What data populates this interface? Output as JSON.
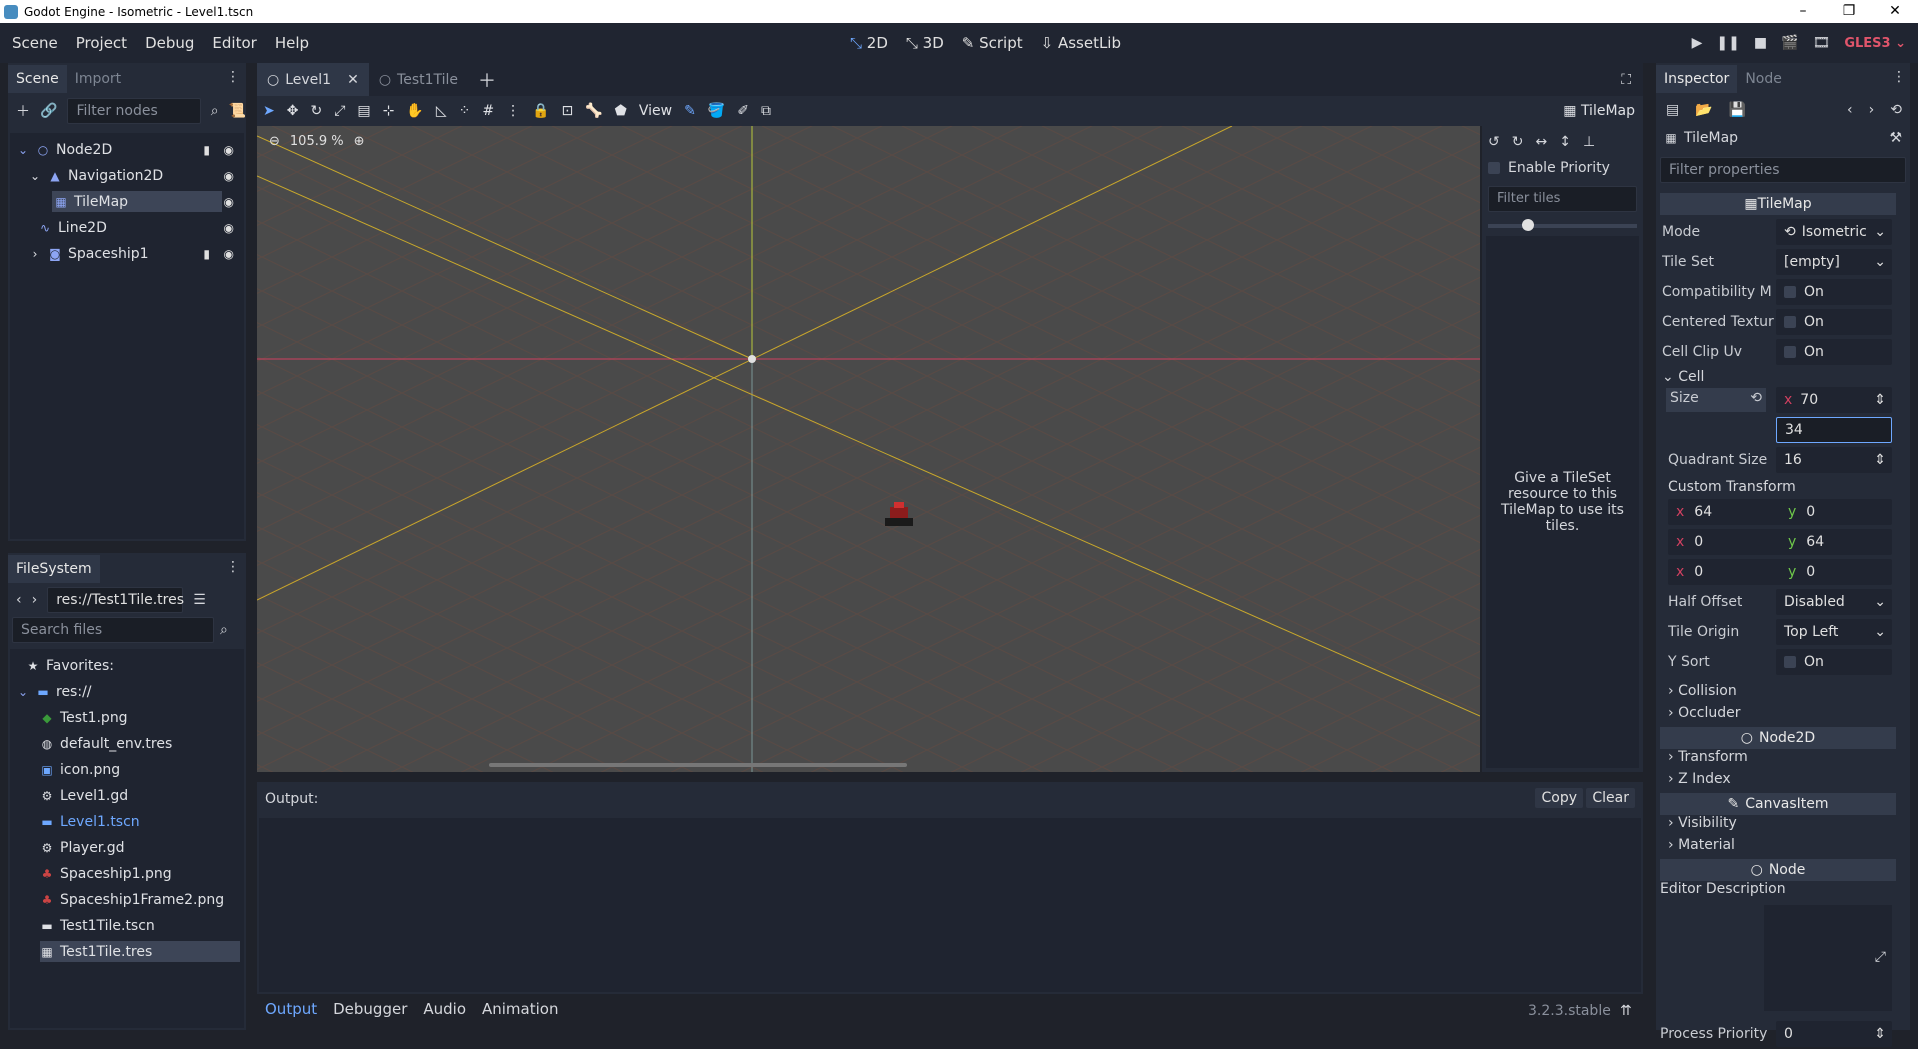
{
  "window": {
    "title": "Godot Engine - Isometric - Level1.tscn",
    "controls": [
      "–",
      "❐",
      "✕"
    ]
  },
  "menu": [
    "Scene",
    "Project",
    "Debug",
    "Editor",
    "Help"
  ],
  "workspaces": {
    "d2": "2D",
    "d3": "3D",
    "script": "Script",
    "assetlib": "AssetLib"
  },
  "renderer": "GLES3",
  "scene_dock": {
    "tab_scene": "Scene",
    "tab_import": "Import",
    "filter_placeholder": "Filter nodes",
    "nodes": [
      "Node2D",
      "Navigation2D",
      "TileMap",
      "Line2D",
      "Spaceship1"
    ]
  },
  "filesystem": {
    "title": "FileSystem",
    "path": "res://Test1Tile.tres",
    "search_placeholder": "Search files",
    "favorites": "Favorites:",
    "root": "res://",
    "files": [
      "Test1.png",
      "default_env.tres",
      "icon.png",
      "Level1.gd",
      "Level1.tscn",
      "Player.gd",
      "Spaceship1.png",
      "Spaceship1Frame2.png",
      "Test1Tile.tscn",
      "Test1Tile.tres"
    ]
  },
  "editor_tabs": [
    "Level1",
    "Test1Tile"
  ],
  "toolbar": {
    "view": "View",
    "tilemap": "TileMap"
  },
  "viewport": {
    "zoom": "105.9 %"
  },
  "tile_panel": {
    "enable_priority": "Enable Priority",
    "filter_placeholder": "Filter tiles",
    "hint": "Give a TileSet resource to this TileMap to use its tiles."
  },
  "output": {
    "label": "Output:",
    "copy": "Copy",
    "clear": "Clear"
  },
  "bottom_tabs": [
    "Output",
    "Debugger",
    "Audio",
    "Animation"
  ],
  "version": "3.2.3.stable",
  "inspector": {
    "tab_inspector": "Inspector",
    "tab_node": "Node",
    "object": "TileMap",
    "filter_placeholder": "Filter properties",
    "class_header": "TileMap",
    "mode_label": "Mode",
    "mode_value": "Isometric",
    "tileset_label": "Tile Set",
    "tileset_value": "[empty]",
    "compat_label": "Compatibility M",
    "compat_value": "On",
    "centered_label": "Centered Textur",
    "centered_value": "On",
    "clipuv_label": "Cell Clip Uv",
    "clipuv_value": "On",
    "cell_section": "Cell",
    "size_label": "Size",
    "size_x_axis": "x",
    "size_x": "70",
    "size_y": "34",
    "quadrant_label": "Quadrant Size",
    "quadrant_value": "16",
    "custom_transform_label": "Custom Transform",
    "ct": [
      [
        "x",
        "64",
        "y",
        "0"
      ],
      [
        "x",
        "0",
        "y",
        "64"
      ],
      [
        "x",
        "0",
        "y",
        "0"
      ]
    ],
    "half_offset_label": "Half Offset",
    "half_offset_value": "Disabled",
    "tile_origin_label": "Tile Origin",
    "tile_origin_value": "Top Left",
    "ysort_label": "Y Sort",
    "ysort_value": "On",
    "collision": "Collision",
    "occluder": "Occluder",
    "node2d_header": "Node2D",
    "transform": "Transform",
    "zindex": "Z Index",
    "canvasitem_header": "CanvasItem",
    "visibility": "Visibility",
    "material": "Material",
    "node_header": "Node",
    "editor_description": "Editor Description",
    "process_priority_label": "Process Priority",
    "process_priority_value": "0"
  }
}
